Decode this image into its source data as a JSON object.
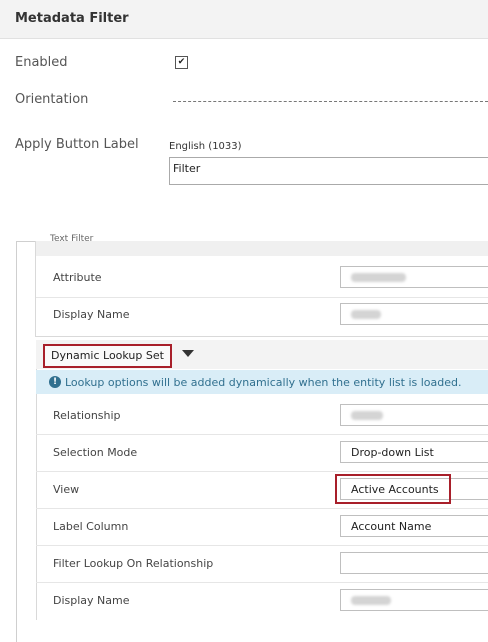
{
  "header": {
    "title": "Metadata Filter"
  },
  "form": {
    "enabled_label": "Enabled",
    "orientation_label": "Orientation",
    "apply_label": "Apply Button Label",
    "language": "English (1033)",
    "apply_value": "Filter"
  },
  "text_filter": {
    "title": "Text Filter",
    "attribute_label": "Attribute",
    "display_name_label": "Display Name"
  },
  "lookup": {
    "title": "Dynamic Lookup Set",
    "info": "Lookup options will be added dynamically when the entity list is loaded.",
    "relationship_label": "Relationship",
    "selection_mode_label": "Selection Mode",
    "selection_mode_value": "Drop-down List",
    "view_label": "View",
    "view_value": "Active Accounts",
    "label_column_label": "Label Column",
    "label_column_value": "Account Name",
    "filter_lookup_label": "Filter Lookup On Relationship",
    "display_name_label": "Display Name"
  },
  "icons": {
    "info": "info-circle-icon",
    "checkbox": "checkmark-icon",
    "dropdown": "caret-down-icon"
  },
  "colors": {
    "highlight": "#a81f2a",
    "info_bg": "#d9edf7",
    "info_text": "#31708f"
  }
}
